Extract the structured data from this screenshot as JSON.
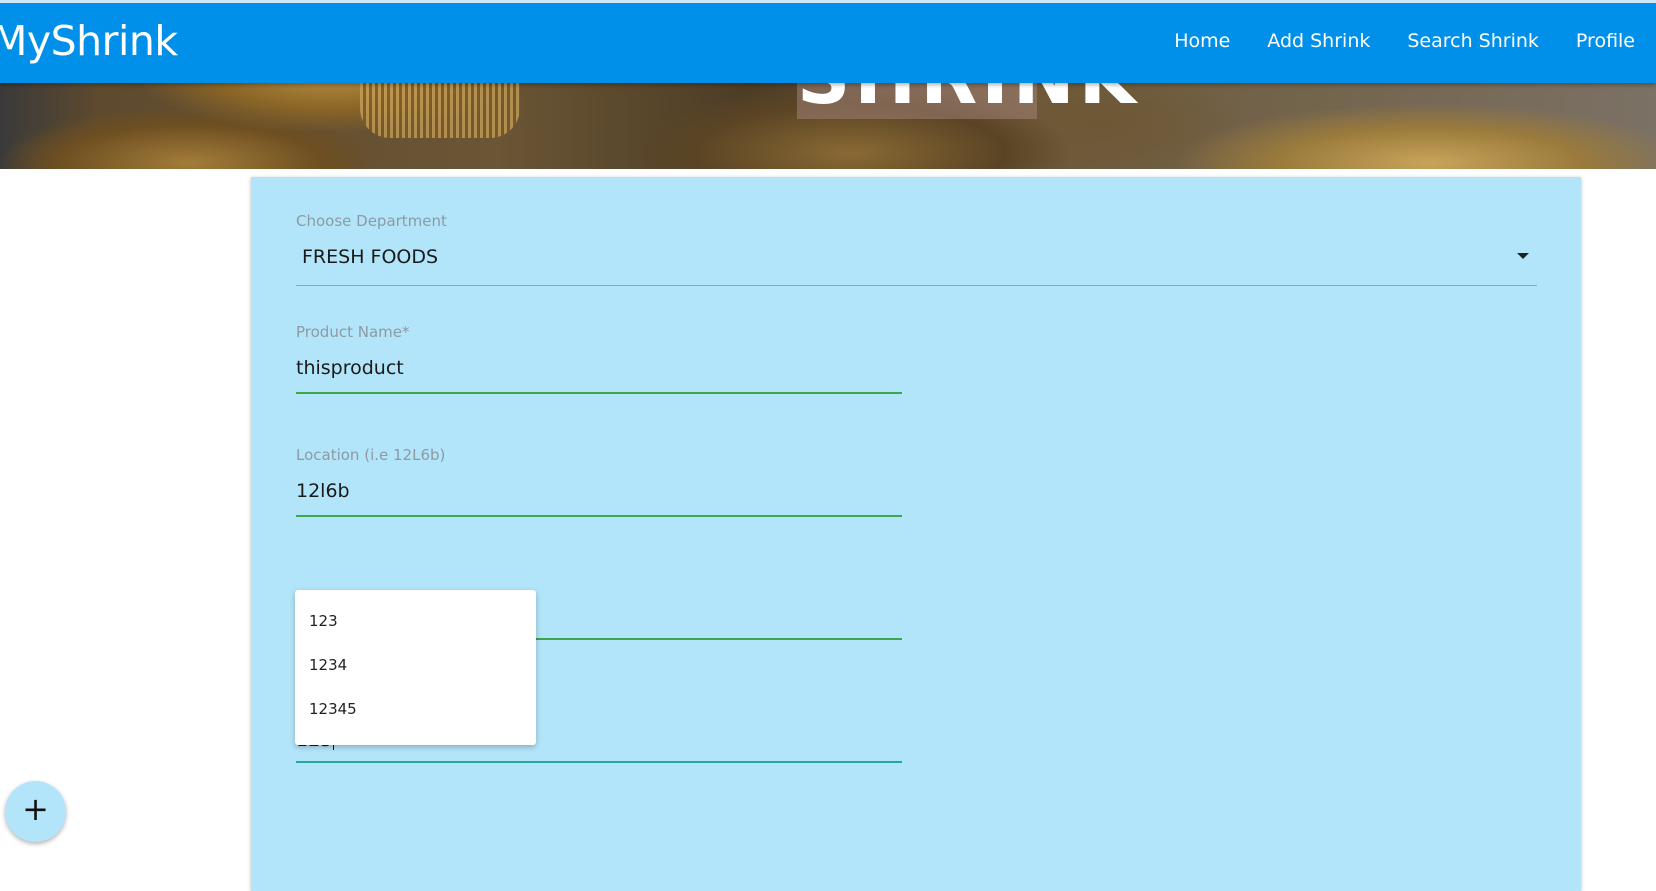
{
  "navbar": {
    "brand": "MyShrink",
    "links": [
      "Home",
      "Add Shrink",
      "Search Shrink",
      "Profile"
    ]
  },
  "hero": {
    "title": "SHRINK"
  },
  "form": {
    "department": {
      "label": "Choose Department",
      "value": "FRESH FOODS"
    },
    "product_name": {
      "label": "Product Name*",
      "value": "thisproduct"
    },
    "location": {
      "label": "Location (i.e 12L6b)",
      "value": "12l6b"
    },
    "last_field": {
      "value": "123"
    }
  },
  "autocomplete": {
    "options": [
      "123",
      "1234",
      "12345"
    ]
  },
  "fab": {
    "icon": "plus-icon",
    "glyph": "+"
  },
  "colors": {
    "navbar": "#0090ea",
    "card": "#b3e5fa",
    "input_active": "#3ca64a",
    "input_focus": "#26a69a"
  }
}
